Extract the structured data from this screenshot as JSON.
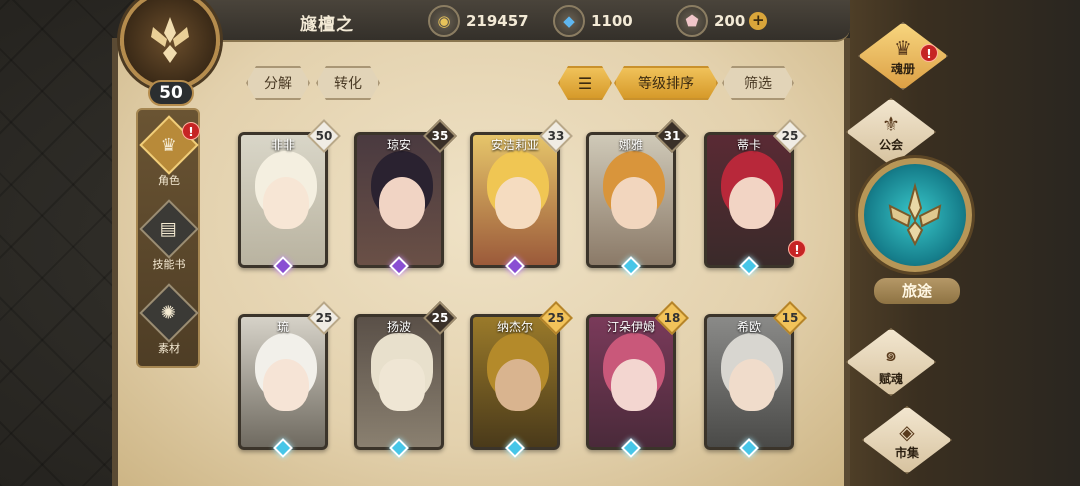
{
  "player": {
    "name": "旞檀之",
    "level": "50"
  },
  "currencies": [
    {
      "icon": "gold-coin-icon",
      "value": "219457"
    },
    {
      "icon": "blue-crystal-icon",
      "value": "1100"
    },
    {
      "icon": "pink-gem-icon",
      "value": "200"
    }
  ],
  "plus_label": "+",
  "toolbar": {
    "decompose": "分解",
    "convert": "转化",
    "sort_level": "等级排序",
    "filter": "筛选"
  },
  "sidenav": [
    {
      "label": "角色",
      "active": true,
      "alert": true
    },
    {
      "label": "技能书",
      "active": false,
      "alert": false
    },
    {
      "label": "素材",
      "active": false,
      "alert": false
    }
  ],
  "alert_mark": "!",
  "cards": [
    {
      "name": "非非",
      "level": "50",
      "badge": "light",
      "rarity": "purple",
      "alert": false
    },
    {
      "name": "琼安",
      "level": "35",
      "badge": "dark",
      "rarity": "purple",
      "alert": false
    },
    {
      "name": "安洁莉亚",
      "level": "33",
      "badge": "light",
      "rarity": "purple",
      "alert": false
    },
    {
      "name": "娜雅",
      "level": "31",
      "badge": "dark",
      "rarity": "blue",
      "alert": false
    },
    {
      "name": "蒂卡",
      "level": "25",
      "badge": "light",
      "rarity": "blue",
      "alert": true
    },
    {
      "name": "琉",
      "level": "25",
      "badge": "light",
      "rarity": "blue",
      "alert": false
    },
    {
      "name": "扬波",
      "level": "25",
      "badge": "dark",
      "rarity": "blue",
      "alert": false
    },
    {
      "name": "纳杰尔",
      "level": "25",
      "badge": "gold",
      "rarity": "blue",
      "alert": false
    },
    {
      "name": "汀朵伊姆",
      "level": "18",
      "badge": "gold",
      "rarity": "blue",
      "alert": false
    },
    {
      "name": "希欧",
      "level": "15",
      "badge": "gold",
      "rarity": "blue",
      "alert": false
    }
  ],
  "right_menu": {
    "soul_book": "魂册",
    "guild": "公会",
    "journey": "旅途",
    "soul_gift": "赋魂",
    "market": "市集"
  },
  "colors": {
    "accent_gold": "#d69a2a",
    "alert_red": "#c62424",
    "journey_teal": "#39c7c9"
  }
}
